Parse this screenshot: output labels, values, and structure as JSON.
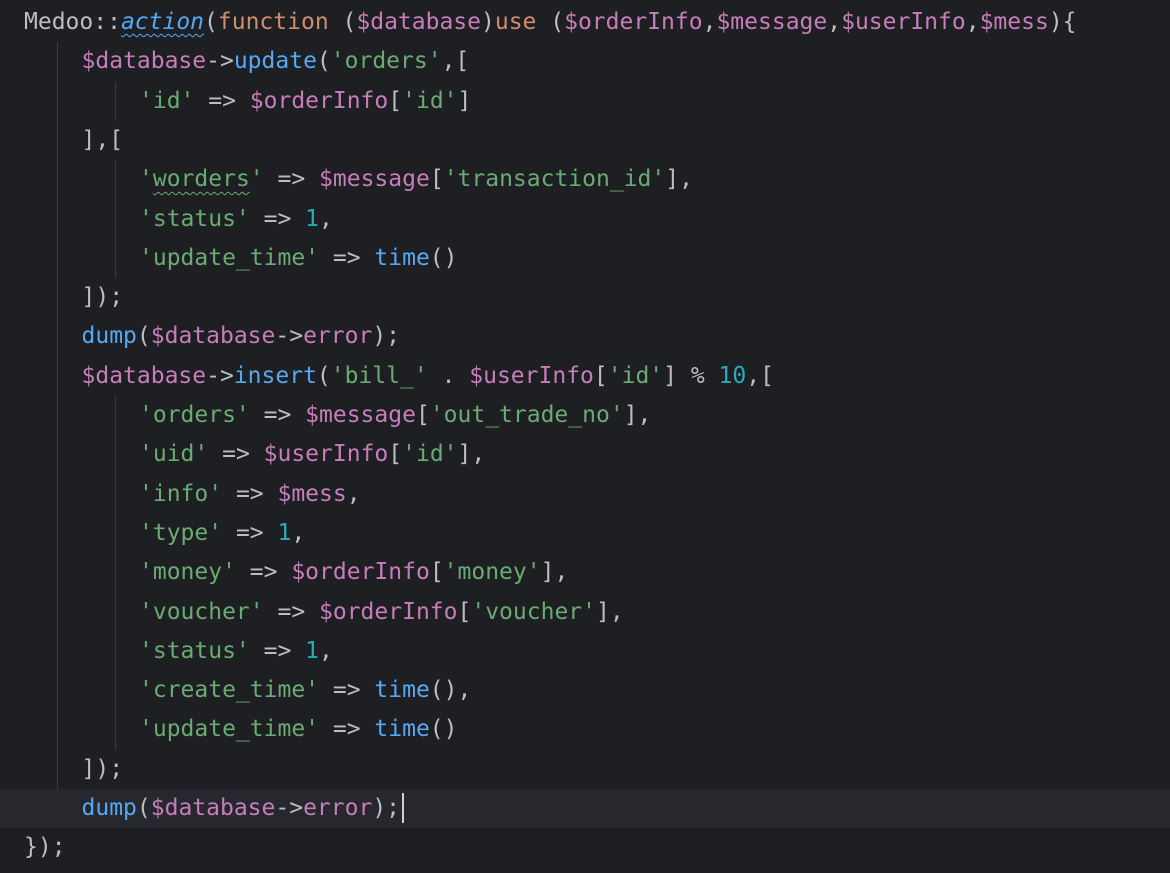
{
  "editor": {
    "colors": {
      "background": "#1e1f22",
      "current_line": "#26282e",
      "plain": "#bcbec4",
      "variable": "#c77dbb",
      "keyword": "#cf8e6d",
      "function": "#56a8f5",
      "string": "#6aab73",
      "number": "#2aacb8"
    },
    "current_line_index": 20,
    "lines": [
      {
        "indent": 0,
        "tokens": [
          {
            "t": "Medoo::",
            "c": "plain"
          },
          {
            "t": "action",
            "c": "fn-italic"
          },
          {
            "t": "(",
            "c": "plain"
          },
          {
            "t": "function",
            "c": "kw"
          },
          {
            "t": " (",
            "c": "plain"
          },
          {
            "t": "$database",
            "c": "var"
          },
          {
            "t": ")",
            "c": "plain"
          },
          {
            "t": "use",
            "c": "kw"
          },
          {
            "t": " (",
            "c": "plain"
          },
          {
            "t": "$orderInfo",
            "c": "var"
          },
          {
            "t": ",",
            "c": "plain"
          },
          {
            "t": "$message",
            "c": "var"
          },
          {
            "t": ",",
            "c": "plain"
          },
          {
            "t": "$userInfo",
            "c": "var"
          },
          {
            "t": ",",
            "c": "plain"
          },
          {
            "t": "$mess",
            "c": "var"
          },
          {
            "t": "){",
            "c": "plain"
          }
        ]
      },
      {
        "indent": 1,
        "tokens": [
          {
            "t": "$database",
            "c": "var"
          },
          {
            "t": "->",
            "c": "plain"
          },
          {
            "t": "update",
            "c": "fn"
          },
          {
            "t": "(",
            "c": "plain"
          },
          {
            "t": "'orders'",
            "c": "str"
          },
          {
            "t": ",[",
            "c": "plain"
          }
        ]
      },
      {
        "indent": 2,
        "tokens": [
          {
            "t": "'id'",
            "c": "str"
          },
          {
            "t": " => ",
            "c": "plain"
          },
          {
            "t": "$orderInfo",
            "c": "var"
          },
          {
            "t": "[",
            "c": "plain"
          },
          {
            "t": "'id'",
            "c": "str"
          },
          {
            "t": "]",
            "c": "plain"
          }
        ]
      },
      {
        "indent": 1,
        "tokens": [
          {
            "t": "],[",
            "c": "plain"
          }
        ]
      },
      {
        "indent": 2,
        "tokens": [
          {
            "t": "'",
            "c": "str"
          },
          {
            "t": "worders",
            "c": "str-typo"
          },
          {
            "t": "'",
            "c": "str"
          },
          {
            "t": " => ",
            "c": "plain"
          },
          {
            "t": "$message",
            "c": "var"
          },
          {
            "t": "[",
            "c": "plain"
          },
          {
            "t": "'transaction_id'",
            "c": "str"
          },
          {
            "t": "],",
            "c": "plain"
          }
        ]
      },
      {
        "indent": 2,
        "tokens": [
          {
            "t": "'status'",
            "c": "str"
          },
          {
            "t": " => ",
            "c": "plain"
          },
          {
            "t": "1",
            "c": "num"
          },
          {
            "t": ",",
            "c": "plain"
          }
        ]
      },
      {
        "indent": 2,
        "tokens": [
          {
            "t": "'update_time'",
            "c": "str"
          },
          {
            "t": " => ",
            "c": "plain"
          },
          {
            "t": "time",
            "c": "fn"
          },
          {
            "t": "()",
            "c": "plain"
          }
        ]
      },
      {
        "indent": 1,
        "tokens": [
          {
            "t": "]);",
            "c": "plain"
          }
        ]
      },
      {
        "indent": 1,
        "tokens": [
          {
            "t": "dump",
            "c": "fn"
          },
          {
            "t": "(",
            "c": "plain"
          },
          {
            "t": "$database",
            "c": "var"
          },
          {
            "t": "->",
            "c": "plain"
          },
          {
            "t": "error",
            "c": "var"
          },
          {
            "t": ");",
            "c": "plain"
          }
        ]
      },
      {
        "indent": 1,
        "tokens": [
          {
            "t": "$database",
            "c": "var"
          },
          {
            "t": "->",
            "c": "plain"
          },
          {
            "t": "insert",
            "c": "fn"
          },
          {
            "t": "(",
            "c": "plain"
          },
          {
            "t": "'bill_'",
            "c": "str"
          },
          {
            "t": " . ",
            "c": "plain"
          },
          {
            "t": "$userInfo",
            "c": "var"
          },
          {
            "t": "[",
            "c": "plain"
          },
          {
            "t": "'id'",
            "c": "str"
          },
          {
            "t": "] % ",
            "c": "plain"
          },
          {
            "t": "10",
            "c": "num"
          },
          {
            "t": ",[",
            "c": "plain"
          }
        ]
      },
      {
        "indent": 2,
        "tokens": [
          {
            "t": "'orders'",
            "c": "str"
          },
          {
            "t": " => ",
            "c": "plain"
          },
          {
            "t": "$message",
            "c": "var"
          },
          {
            "t": "[",
            "c": "plain"
          },
          {
            "t": "'out_trade_no'",
            "c": "str"
          },
          {
            "t": "],",
            "c": "plain"
          }
        ]
      },
      {
        "indent": 2,
        "tokens": [
          {
            "t": "'uid'",
            "c": "str"
          },
          {
            "t": " => ",
            "c": "plain"
          },
          {
            "t": "$userInfo",
            "c": "var"
          },
          {
            "t": "[",
            "c": "plain"
          },
          {
            "t": "'id'",
            "c": "str"
          },
          {
            "t": "],",
            "c": "plain"
          }
        ]
      },
      {
        "indent": 2,
        "tokens": [
          {
            "t": "'info'",
            "c": "str"
          },
          {
            "t": " => ",
            "c": "plain"
          },
          {
            "t": "$mess",
            "c": "var"
          },
          {
            "t": ",",
            "c": "plain"
          }
        ]
      },
      {
        "indent": 2,
        "tokens": [
          {
            "t": "'type'",
            "c": "str"
          },
          {
            "t": " => ",
            "c": "plain"
          },
          {
            "t": "1",
            "c": "num"
          },
          {
            "t": ",",
            "c": "plain"
          }
        ]
      },
      {
        "indent": 2,
        "tokens": [
          {
            "t": "'money'",
            "c": "str"
          },
          {
            "t": " => ",
            "c": "plain"
          },
          {
            "t": "$orderInfo",
            "c": "var"
          },
          {
            "t": "[",
            "c": "plain"
          },
          {
            "t": "'money'",
            "c": "str"
          },
          {
            "t": "],",
            "c": "plain"
          }
        ]
      },
      {
        "indent": 2,
        "tokens": [
          {
            "t": "'voucher'",
            "c": "str"
          },
          {
            "t": " => ",
            "c": "plain"
          },
          {
            "t": "$orderInfo",
            "c": "var"
          },
          {
            "t": "[",
            "c": "plain"
          },
          {
            "t": "'voucher'",
            "c": "str"
          },
          {
            "t": "],",
            "c": "plain"
          }
        ]
      },
      {
        "indent": 2,
        "tokens": [
          {
            "t": "'status'",
            "c": "str"
          },
          {
            "t": " => ",
            "c": "plain"
          },
          {
            "t": "1",
            "c": "num"
          },
          {
            "t": ",",
            "c": "plain"
          }
        ]
      },
      {
        "indent": 2,
        "tokens": [
          {
            "t": "'create_time'",
            "c": "str"
          },
          {
            "t": " => ",
            "c": "plain"
          },
          {
            "t": "time",
            "c": "fn"
          },
          {
            "t": "(),",
            "c": "plain"
          }
        ]
      },
      {
        "indent": 2,
        "tokens": [
          {
            "t": "'update_time'",
            "c": "str"
          },
          {
            "t": " => ",
            "c": "plain"
          },
          {
            "t": "time",
            "c": "fn"
          },
          {
            "t": "()",
            "c": "plain"
          }
        ]
      },
      {
        "indent": 1,
        "tokens": [
          {
            "t": "]);",
            "c": "plain"
          }
        ]
      },
      {
        "indent": 1,
        "tokens": [
          {
            "t": "dump",
            "c": "fn"
          },
          {
            "t": "(",
            "c": "plain"
          },
          {
            "t": "$database",
            "c": "var"
          },
          {
            "t": "->",
            "c": "plain"
          },
          {
            "t": "error",
            "c": "var"
          },
          {
            "t": ");",
            "c": "plain"
          }
        ]
      },
      {
        "indent": 0,
        "tokens": [
          {
            "t": "});",
            "c": "plain"
          }
        ]
      }
    ]
  }
}
